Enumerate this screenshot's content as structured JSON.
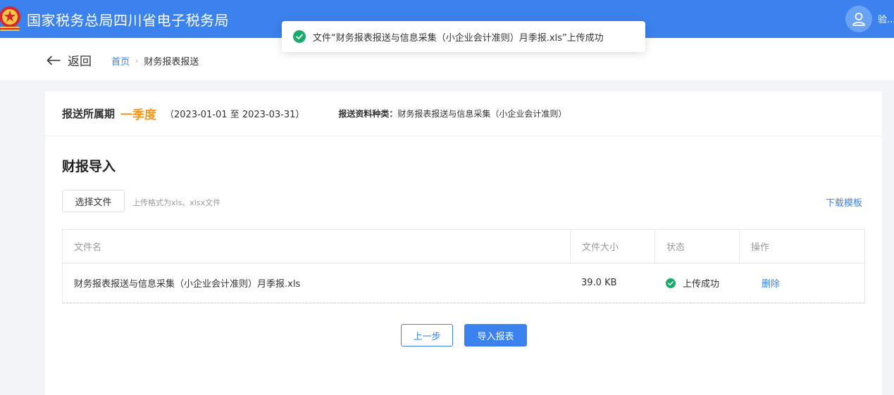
{
  "header": {
    "site_title": "国家税务总局四川省电子税务局",
    "username": "验..."
  },
  "toast": {
    "message": "文件“财务报表报送与信息采集（小企业会计准则）月季报.xls”上传成功",
    "icon": "check-circle-icon"
  },
  "nav": {
    "back_label": "返回",
    "breadcrumb": [
      {
        "label": "首页"
      },
      {
        "label": "财务报表报送"
      }
    ]
  },
  "period": {
    "label": "报送所属期",
    "value": "一季度",
    "range": "（2023-01-01 至 2023-03-31）",
    "type_label": "报送资料种类：",
    "type_value": "财务报表报送与信息采集（小企业会计准则）"
  },
  "import_section": {
    "title": "财报导入",
    "choose_file_label": "选择文件",
    "hint": "上传格式为xls、xlsx文件",
    "download_template_label": "下载模板"
  },
  "table": {
    "columns": [
      "文件名",
      "文件大小",
      "状态",
      "操作"
    ],
    "rows": [
      {
        "file_name": "财务报表报送与信息采集（小企业会计准则）月季报.xls",
        "file_size": "39.0 KB",
        "status": "上传成功",
        "action": "删除"
      }
    ]
  },
  "actions": {
    "prev_label": "上一步",
    "import_label": "导入报表"
  },
  "colors": {
    "primary": "#3b82ee",
    "accent_orange": "#f39a1e",
    "success": "#1aab6a"
  }
}
